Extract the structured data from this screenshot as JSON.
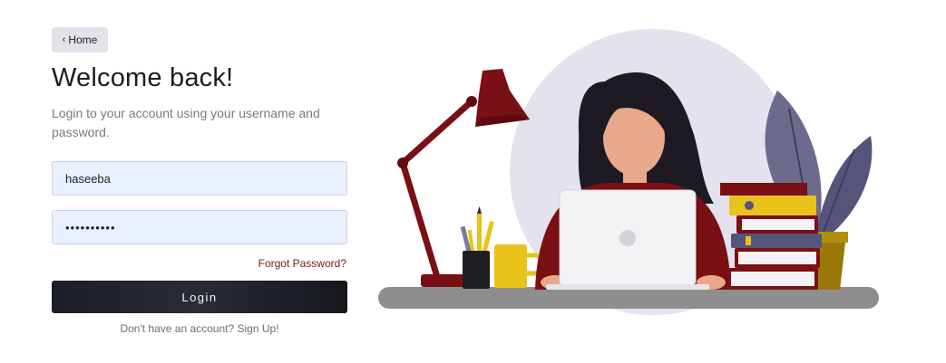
{
  "nav": {
    "home_chevron": "‹",
    "home_label": "Home"
  },
  "heading": {
    "title": "Welcome back!",
    "subtitle": "Login to your account using your username and password."
  },
  "form": {
    "username_value": "haseeba",
    "password_value": "••••••••••",
    "forgot_label": "Forgot Password?",
    "login_label": "Login",
    "signup_label": "Don't have an account? Sign Up!"
  },
  "colors": {
    "accent_dark": "#1c1f27",
    "link": "#7b1414",
    "input_bg": "#e8f0fe",
    "home_bg": "#e2e2ea"
  },
  "illustration": {
    "icon": "woman-at-desk-illustration"
  }
}
